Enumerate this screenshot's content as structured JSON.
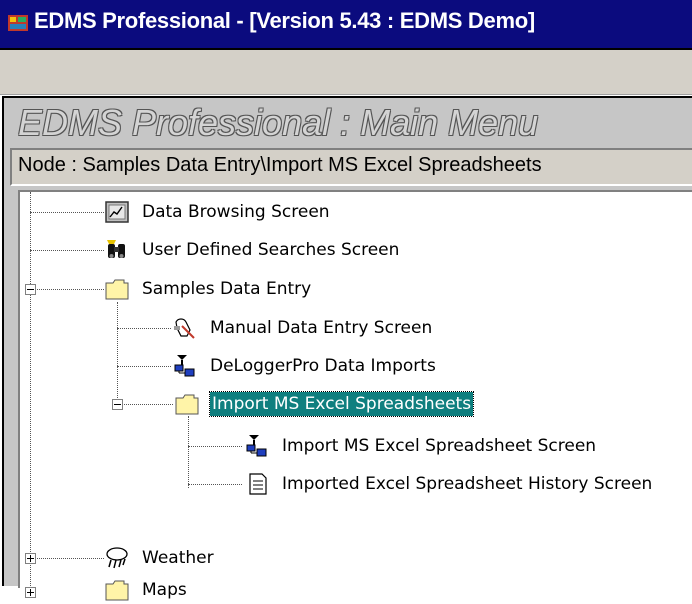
{
  "window": {
    "title": "EDMS Professional - [Version 5.43 : EDMS Demo]",
    "icon": "edms-app-icon"
  },
  "main_menu": {
    "heading": "EDMS Professional : Main Menu",
    "node_path": "Node : Samples Data Entry\\Import MS Excel Spreadsheets"
  },
  "tree": {
    "items": [
      {
        "label": "Data Browsing Screen",
        "icon": "chart-screen-icon"
      },
      {
        "label": "User Defined Searches Screen",
        "icon": "binoculars-icon"
      },
      {
        "label": "Samples Data Entry",
        "icon": "folder-icon",
        "expanded": true
      },
      {
        "label": "Manual Data Entry Screen",
        "icon": "hand-pen-icon"
      },
      {
        "label": "DeLoggerPro Data Imports",
        "icon": "network-import-icon"
      },
      {
        "label": "Import MS Excel Spreadsheets",
        "icon": "folder-icon",
        "expanded": true,
        "selected": true
      },
      {
        "label": "Import MS Excel Spreadsheet Screen",
        "icon": "network-import-icon"
      },
      {
        "label": "Imported Excel Spreadsheet History Screen",
        "icon": "document-icon"
      },
      {
        "label": "Weather",
        "icon": "weather-icon",
        "expanded": false
      },
      {
        "label": "Maps",
        "icon": "folder-icon",
        "expanded": false
      }
    ]
  },
  "colors": {
    "titlebar": "#0b0b7e",
    "selection": "#0f7f7f",
    "folder": "#fff4a8"
  }
}
